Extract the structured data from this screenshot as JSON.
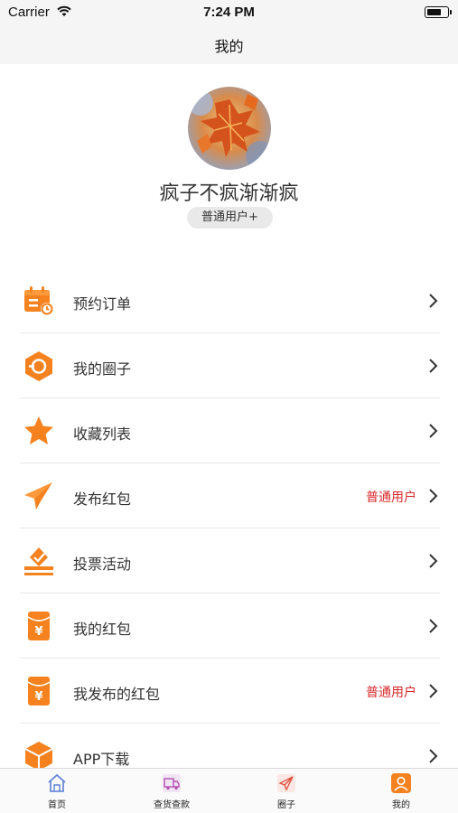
{
  "status_bar": {
    "carrier": "Carrier",
    "time": "7:24 PM",
    "battery_level": 0.7
  },
  "nav": {
    "title": "我的"
  },
  "profile": {
    "username": "疯子不疯渐渐疯",
    "user_level": "普通用户+"
  },
  "menu": {
    "items": [
      {
        "label": "预约订单",
        "tag": "",
        "icon": "calendar-clock-icon"
      },
      {
        "label": "我的圈子",
        "tag": "",
        "icon": "circle-hexagon-icon"
      },
      {
        "label": "收藏列表",
        "tag": "",
        "icon": "star-icon"
      },
      {
        "label": "发布红包",
        "tag": "普通用户",
        "icon": "paper-plane-icon"
      },
      {
        "label": "投票活动",
        "tag": "",
        "icon": "ballot-box-icon"
      },
      {
        "label": "我的红包",
        "tag": "",
        "icon": "red-envelope-icon"
      },
      {
        "label": "我发布的红包",
        "tag": "普通用户",
        "icon": "red-envelope-icon"
      },
      {
        "label": "APP下载",
        "tag": "",
        "icon": "download-box-icon"
      }
    ]
  },
  "tabs": [
    {
      "label": "首页",
      "icon": "home-icon"
    },
    {
      "label": "查货查款",
      "icon": "delivery-truck-icon"
    },
    {
      "label": "圈子",
      "icon": "paper-plane-icon"
    },
    {
      "label": "我的",
      "icon": "user-icon"
    }
  ],
  "colors": {
    "accent_orange": "#f5821f",
    "tag_red": "#d9282a",
    "bar_gray": "#f5f5f5"
  }
}
